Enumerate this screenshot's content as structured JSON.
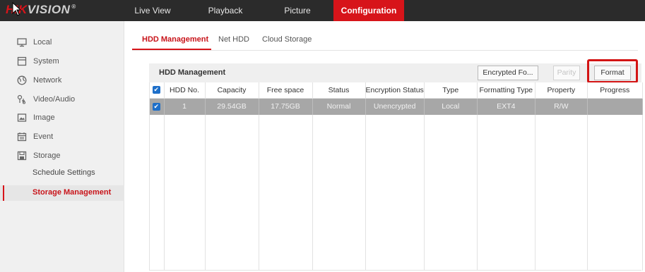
{
  "header": {
    "brand_accent": "HIK",
    "brand_rest": "VISION",
    "brand_mark": "®",
    "nav": [
      "Live View",
      "Playback",
      "Picture",
      "Configuration"
    ],
    "active_nav": "Configuration",
    "accent_color": "#d7141a"
  },
  "sidebar": {
    "items": [
      {
        "label": "Local",
        "icon": "monitor-icon"
      },
      {
        "label": "System",
        "icon": "system-icon"
      },
      {
        "label": "Network",
        "icon": "globe-icon"
      },
      {
        "label": "Video/Audio",
        "icon": "audio-video-icon"
      },
      {
        "label": "Image",
        "icon": "image-icon"
      },
      {
        "label": "Event",
        "icon": "calendar-icon"
      },
      {
        "label": "Storage",
        "icon": "floppy-icon"
      }
    ],
    "subitems": [
      "Schedule Settings",
      "Storage Management"
    ],
    "active_subitem": "Storage Management"
  },
  "tabs": [
    "HDD Management",
    "Net HDD",
    "Cloud Storage"
  ],
  "active_tab": "HDD Management",
  "panel": {
    "title": "HDD Management",
    "buttons": {
      "encrypted": "Encrypted Fo...",
      "parity": "Parity",
      "format": "Format"
    }
  },
  "table": {
    "columns": [
      "HDD No.",
      "Capacity",
      "Free space",
      "Status",
      "Encryption Status",
      "Type",
      "Formatting Type",
      "Property",
      "Progress"
    ],
    "rows": [
      {
        "hdd_no": "1",
        "capacity": "29.54GB",
        "free_space": "17.75GB",
        "status": "Normal",
        "encryption_status": "Unencrypted",
        "type": "Local",
        "formatting_type": "EXT4",
        "property": "R/W",
        "progress": ""
      }
    ]
  }
}
